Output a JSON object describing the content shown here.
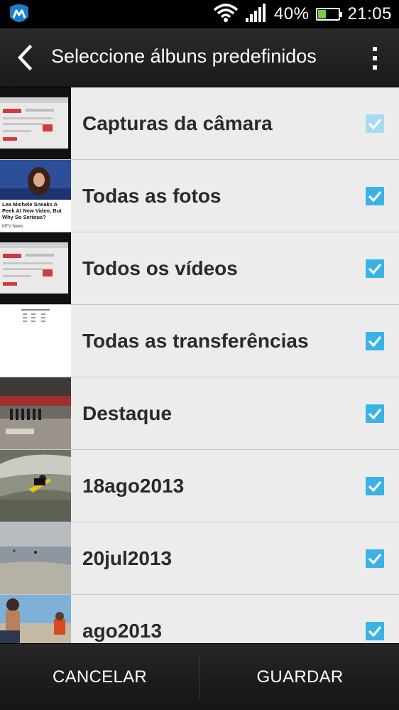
{
  "status_bar": {
    "battery_percent": "40%",
    "battery_level": 0.4,
    "time": "21:05",
    "icons": [
      "app-notification-icon",
      "wifi-icon",
      "signal-icon",
      "battery-icon"
    ]
  },
  "action_bar": {
    "title": "Seleccione álbuns predefinidos",
    "back_icon": "chevron-left-icon",
    "overflow_icon": "overflow-menu-icon"
  },
  "albums": [
    {
      "label": "Capturas da câmara",
      "checked": true,
      "enabled": false,
      "thumb": "screen"
    },
    {
      "label": "Todas as fotos",
      "checked": true,
      "enabled": true,
      "thumb": "news",
      "thumb_text": "Lea Michele Sneaks A Peek At New Video, But Why So Serious?",
      "thumb_brand": "MTV News"
    },
    {
      "label": "Todos os vídeos",
      "checked": true,
      "enabled": true,
      "thumb": "screen"
    },
    {
      "label": "Todas as transferências",
      "checked": true,
      "enabled": true,
      "thumb": "document"
    },
    {
      "label": "Destaque",
      "checked": true,
      "enabled": true,
      "thumb": "gym"
    },
    {
      "label": "18ago2013",
      "checked": true,
      "enabled": true,
      "thumb": "surf"
    },
    {
      "label": "20jul2013",
      "checked": true,
      "enabled": true,
      "thumb": "sea"
    },
    {
      "label": "ago2013",
      "checked": true,
      "enabled": true,
      "thumb": "beach"
    }
  ],
  "bottom_bar": {
    "cancel_label": "CANCELAR",
    "save_label": "GUARDAR"
  },
  "colors": {
    "accent": "#39b3e6",
    "accent_disabled": "#a6dcf0",
    "list_background": "#ececec"
  }
}
